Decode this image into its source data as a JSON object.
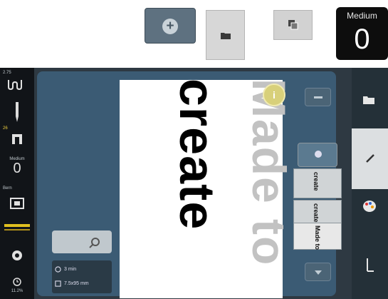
{
  "legend": {
    "plus_icon": "+",
    "medium_label": "Medium",
    "medium_value": "0"
  },
  "sidebar": {
    "top_value": "2.75",
    "stitch_num": "26",
    "presser_label": "Medium",
    "presser_value": "0",
    "bobbin_label": "Bern",
    "bottom_value": "11.2%"
  },
  "canvas": {
    "text_create": "create",
    "text_made": "Made to"
  },
  "info": {
    "time": "3 min",
    "size": "7.5x95 mm"
  },
  "layers": {
    "layer1_text": "create",
    "layer2_text": "create",
    "layer3_text": "Made to"
  },
  "colors": {
    "screen_bg": "#2e3942",
    "canvas_area": "#3b5b74",
    "sidebar_bg": "#111418",
    "info_btn": "#d8d07a"
  }
}
